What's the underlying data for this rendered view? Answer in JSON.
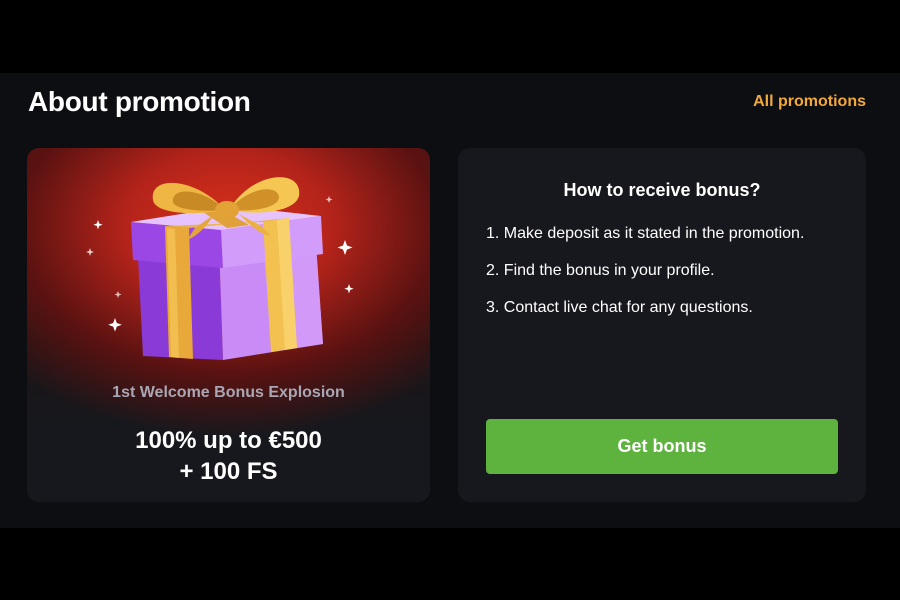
{
  "header": {
    "title": "About promotion",
    "all_promotions_label": "All promotions"
  },
  "promo": {
    "name": "1st Welcome Bonus Explosion",
    "offer_line1": "100% up to €500",
    "offer_line2": "+ 100 FS",
    "image_icon": "gift-box-icon"
  },
  "info": {
    "heading": "How to receive bonus?",
    "steps": [
      "1. Make deposit as it stated in the promotion.",
      "2. Find the bonus in your profile.",
      "3. Contact live chat for any questions."
    ],
    "button_label": "Get bonus"
  },
  "colors": {
    "accent_link": "#f2a93b",
    "button_green": "#5db33e",
    "card_bg": "#17181d",
    "page_bg": "#0d0e12"
  }
}
